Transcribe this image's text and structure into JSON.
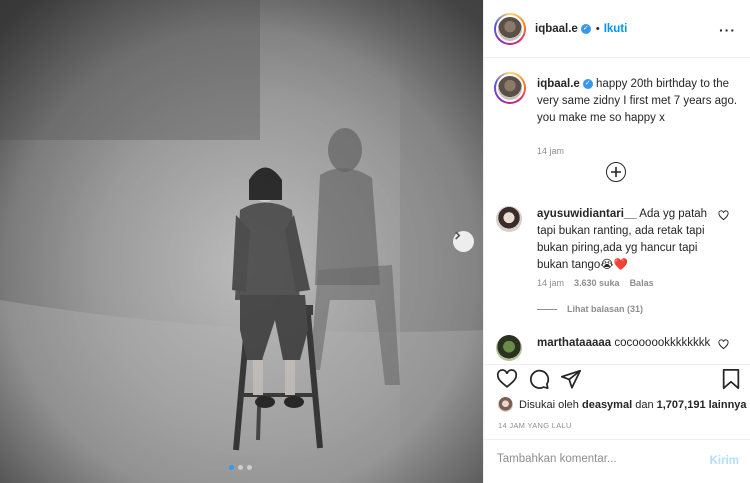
{
  "post": {
    "author": "iqbaal.e",
    "follow_label": "Ikuti",
    "more_icon": "more-horizontal-icon",
    "photo_alt": "Black and white photo of a woman sitting on a tall stool with her shadow on the wall",
    "carousel": {
      "count": 3,
      "active": 1
    }
  },
  "caption": {
    "username": "iqbaal.e",
    "text": "happy 20th birthday to the very same zidny I first met 7 years ago. you make me so happy x",
    "time": "14 jam"
  },
  "comments": [
    {
      "username": "ayusuwidiantari__",
      "text": "Ada yg patah tapi bukan ranting, ada retak tapi bukan piring,ada yg hancur tapi bukan tango😭❤️",
      "time": "14 jam",
      "likes": "3.630 suka",
      "reply_label": "Balas",
      "view_replies": "Lihat balasan (31)"
    },
    {
      "username": "marthataaaaa",
      "text": "cocoooookkkkkkkk"
    }
  ],
  "likes": {
    "prefix": "Disukai oleh",
    "user": "deasymal",
    "and": "dan",
    "count": "1,707,191 lainnya"
  },
  "time_ago": "14 JAM YANG LALU",
  "add_comment": {
    "placeholder": "Tambahkan komentar...",
    "post_label": "Kirim"
  },
  "colors": {
    "link_blue": "#0095f6",
    "verified_blue": "#3897f0",
    "muted": "#8e8e8e"
  }
}
